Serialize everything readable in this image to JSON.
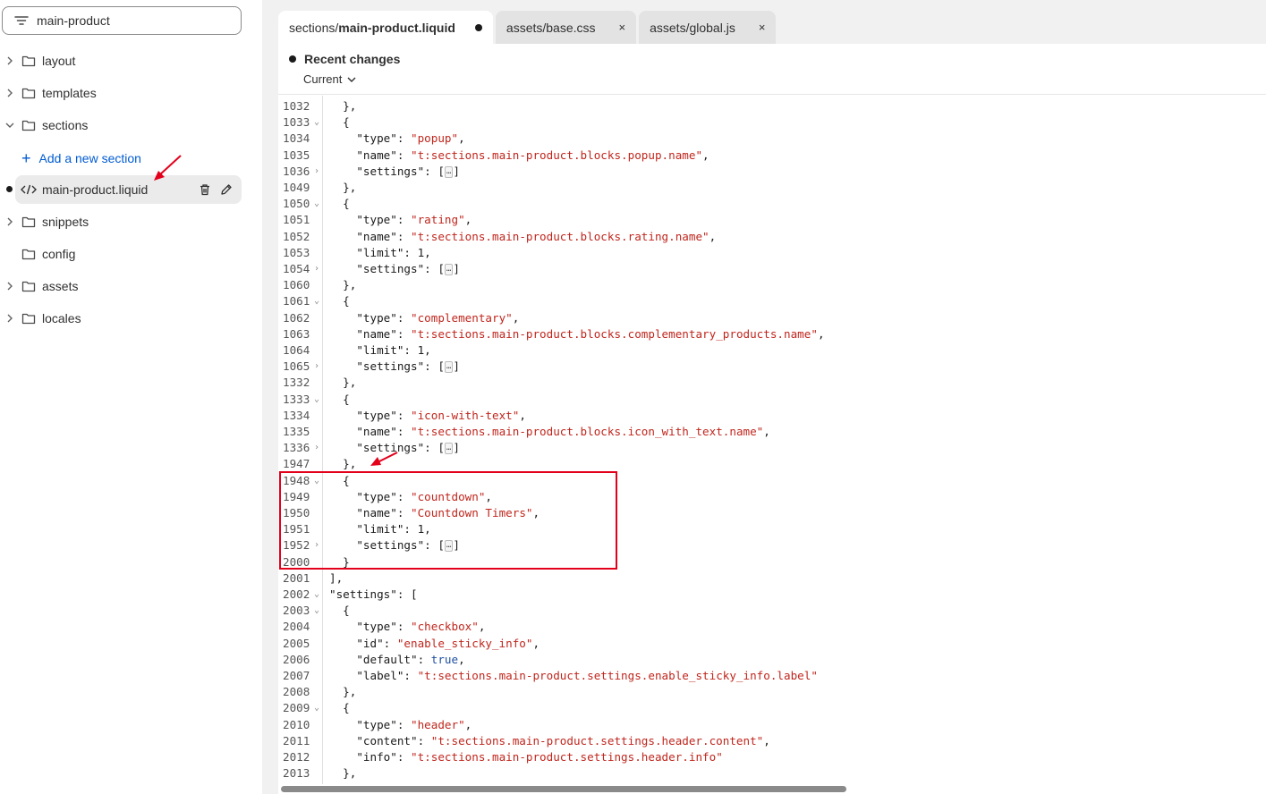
{
  "sidebar": {
    "search_value": "main-product",
    "items": [
      {
        "label": "layout"
      },
      {
        "label": "templates"
      },
      {
        "label": "sections"
      },
      {
        "label": "snippets"
      },
      {
        "label": "config"
      },
      {
        "label": "assets"
      },
      {
        "label": "locales"
      }
    ],
    "add_section_label": "Add a new section",
    "file_label": "main-product.liquid"
  },
  "tabs": [
    {
      "prefix": "sections/",
      "name": "main-product.liquid",
      "state": "modified"
    },
    {
      "label": "assets/base.css",
      "close": "×"
    },
    {
      "label": "assets/global.js",
      "close": "×"
    }
  ],
  "panel": {
    "recent_changes": "Recent changes",
    "current": "Current"
  },
  "code_lines": [
    {
      "n": "1032",
      "fold": "",
      "html": "  },"
    },
    {
      "n": "1033",
      "fold": "v",
      "html": "  {"
    },
    {
      "n": "1034",
      "fold": "",
      "html": "    \"type\": <s>\"popup\"</s>,"
    },
    {
      "n": "1035",
      "fold": "",
      "html": "    \"name\": <s>\"t:sections.main-product.blocks.popup.name\"</s>,"
    },
    {
      "n": "1036",
      "fold": ">",
      "html": "    \"settings\": [<e>…</e>]"
    },
    {
      "n": "1049",
      "fold": "",
      "html": "  },"
    },
    {
      "n": "1050",
      "fold": "v",
      "html": "  {"
    },
    {
      "n": "1051",
      "fold": "",
      "html": "    \"type\": <s>\"rating\"</s>,"
    },
    {
      "n": "1052",
      "fold": "",
      "html": "    \"name\": <s>\"t:sections.main-product.blocks.rating.name\"</s>,"
    },
    {
      "n": "1053",
      "fold": "",
      "html": "    \"limit\": 1,"
    },
    {
      "n": "1054",
      "fold": ">",
      "html": "    \"settings\": [<e>…</e>]"
    },
    {
      "n": "1060",
      "fold": "",
      "html": "  },"
    },
    {
      "n": "1061",
      "fold": "v",
      "html": "  {"
    },
    {
      "n": "1062",
      "fold": "",
      "html": "    \"type\": <s>\"complementary\"</s>,"
    },
    {
      "n": "1063",
      "fold": "",
      "html": "    \"name\": <s>\"t:sections.main-product.blocks.complementary_products.name\"</s>,"
    },
    {
      "n": "1064",
      "fold": "",
      "html": "    \"limit\": 1,"
    },
    {
      "n": "1065",
      "fold": ">",
      "html": "    \"settings\": [<e>…</e>]"
    },
    {
      "n": "1332",
      "fold": "",
      "html": "  },"
    },
    {
      "n": "1333",
      "fold": "v",
      "html": "  {"
    },
    {
      "n": "1334",
      "fold": "",
      "html": "    \"type\": <s>\"icon-with-text\"</s>,"
    },
    {
      "n": "1335",
      "fold": "",
      "html": "    \"name\": <s>\"t:sections.main-product.blocks.icon_with_text.name\"</s>,"
    },
    {
      "n": "1336",
      "fold": ">",
      "html": "    \"settings\": [<e>…</e>]"
    },
    {
      "n": "1947",
      "fold": "",
      "html": "  },"
    },
    {
      "n": "1948",
      "fold": "v",
      "html": "  {"
    },
    {
      "n": "1949",
      "fold": "",
      "html": "    \"type\": <s>\"countdown\"</s>,"
    },
    {
      "n": "1950",
      "fold": "",
      "html": "    \"name\": <s>\"Countdown Timers\"</s>,"
    },
    {
      "n": "1951",
      "fold": "",
      "html": "    \"limit\": 1,"
    },
    {
      "n": "1952",
      "fold": ">",
      "html": "    \"settings\": [<e>…</e>]"
    },
    {
      "n": "2000",
      "fold": "",
      "html": "  }"
    },
    {
      "n": "2001",
      "fold": "",
      "html": "],"
    },
    {
      "n": "2002",
      "fold": "v",
      "html": "\"settings\": ["
    },
    {
      "n": "2003",
      "fold": "v",
      "html": "  {"
    },
    {
      "n": "2004",
      "fold": "",
      "html": "    \"type\": <s>\"checkbox\"</s>,"
    },
    {
      "n": "2005",
      "fold": "",
      "html": "    \"id\": <s>\"enable_sticky_info\"</s>,"
    },
    {
      "n": "2006",
      "fold": "",
      "html": "    \"default\": <b>true</b>,"
    },
    {
      "n": "2007",
      "fold": "",
      "html": "    \"label\": <s>\"t:sections.main-product.settings.enable_sticky_info.label\"</s>"
    },
    {
      "n": "2008",
      "fold": "",
      "html": "  },"
    },
    {
      "n": "2009",
      "fold": "v",
      "html": "  {"
    },
    {
      "n": "2010",
      "fold": "",
      "html": "    \"type\": <s>\"header\"</s>,"
    },
    {
      "n": "2011",
      "fold": "",
      "html": "    \"content\": <s>\"t:sections.main-product.settings.header.content\"</s>,"
    },
    {
      "n": "2012",
      "fold": "",
      "html": "    \"info\": <s>\"t:sections.main-product.settings.header.info\"</s>"
    },
    {
      "n": "2013",
      "fold": "",
      "html": "  },"
    }
  ],
  "colors": {
    "string": "#c0261d",
    "link": "#005bd3",
    "annotation": "#e3001b"
  }
}
